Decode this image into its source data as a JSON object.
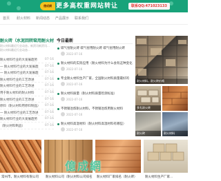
{
  "banner": {
    "ribbon": "億成網",
    "headline": "更多高权重网站转让",
    "contact": "联系QQ:471023133",
    "brand_color": "#18a37a",
    "accent": "#f4c21e"
  },
  "nav": {
    "links": [
      "首页",
      "耐火材料",
      "新闻动态",
      "产品展示",
      "联系我们"
    ]
  },
  "left": {
    "hero_title": "耐火砖（水泥回转窑用耐火材料）",
    "hero_sub": "耐火材料最近行业动态，新资讯新资讯…",
    "hero_sub2": "耐火材料最近行业动态…",
    "articles": [
      {
        "title": "耐火材料行业的大发展趋势",
        "date": "07-16"
      },
      {
        "title": "一 耐火材料行业的大发展趋势",
        "date": "07-16"
      },
      {
        "title": "一 耐火材料行业的大发展趋势",
        "date": "07-16"
      },
      {
        "title": "耐火材料行业的工艺改进",
        "date": "07-16"
      },
      {
        "title": "耐火材料行业的工艺改进",
        "date": "07-16"
      },
      {
        "title": "用于耐火材料的耐火材料",
        "date": "07-16"
      },
      {
        "title": "耐火材料行业的工艺改进",
        "date": "07-16"
      },
      {
        "title": "原料（耐火材料用原料制品）",
        "date": "07-16"
      },
      {
        "title": "一 耐火材料行业的工艺改进",
        "date": "07-16"
      },
      {
        "title": "耐火材料行业的大发展趋势",
        "date": "07-16"
      },
      {
        "title": "（耐火材料制品）",
        "date": "07-16"
      }
    ]
  },
  "middle": {
    "section_title": "今日最新",
    "news": [
      {
        "title": "碳气窑耐火砖 碳气窑用耐火砖 碳气窑用耐火砖",
        "date": "2022-07-16"
      },
      {
        "title": "耐火材料的实际应用（耐火材料为什么会有这种变化）",
        "date": "2022-07-16"
      },
      {
        "title": "专业耐火材料生产厂家，全国耐火材料质量最好的",
        "date": "2022-07-16"
      },
      {
        "title": "耐火材料质量（耐火材料质量检测标准）",
        "date": "2022-07-16"
      },
      {
        "title": "不锈钢冶炼耐火材料，不锈钢冶炼用耐火材料",
        "date": "2022-07-16"
      },
      {
        "title": "耐火材料高温材料（耐火材料高温材料有哪些）",
        "date": "2022-07-16"
      }
    ]
  },
  "right": {
    "captions": [
      "耐火材料，耐火砖价格",
      "多孔耐火砖",
      "耐火砖",
      "耐火材料"
    ]
  },
  "bottom": {
    "watermark": "億成網",
    "captions": [
      "常州市，耐火材料有限公司",
      "耐火材料公司（耐火材料公司排名）",
      "耐火材料厂家排名（耐火砖）",
      "耐火材料生产厂家…"
    ]
  }
}
